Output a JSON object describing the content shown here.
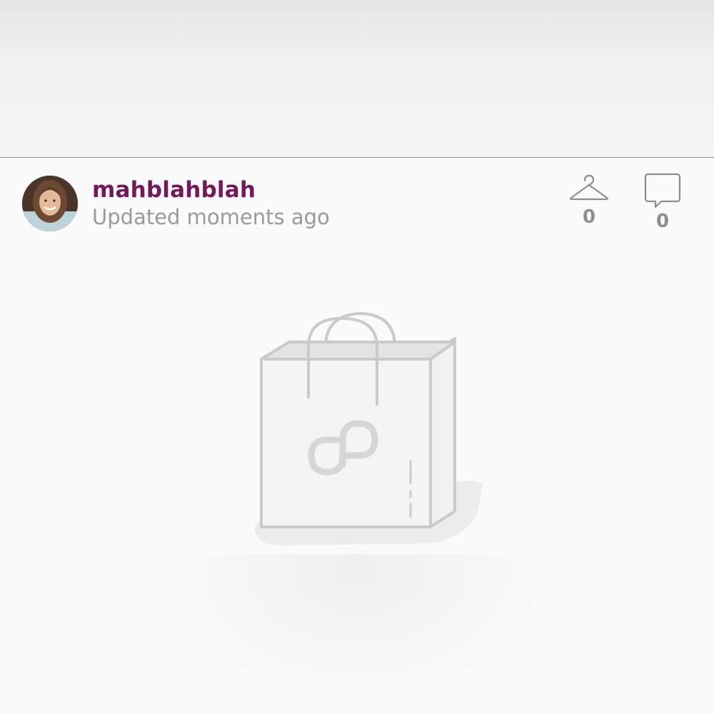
{
  "post": {
    "username": "mahblahblah",
    "updated": "Updated moments ago",
    "likes_count": "0",
    "comments_count": "0"
  },
  "icons": {
    "likes": "hanger-icon",
    "comments": "speech-bubble-icon",
    "placeholder": "shopping-bag-icon"
  },
  "colors": {
    "username": "#731859",
    "muted_text": "#9a999b",
    "icon_stroke": "#8e8d8f"
  }
}
